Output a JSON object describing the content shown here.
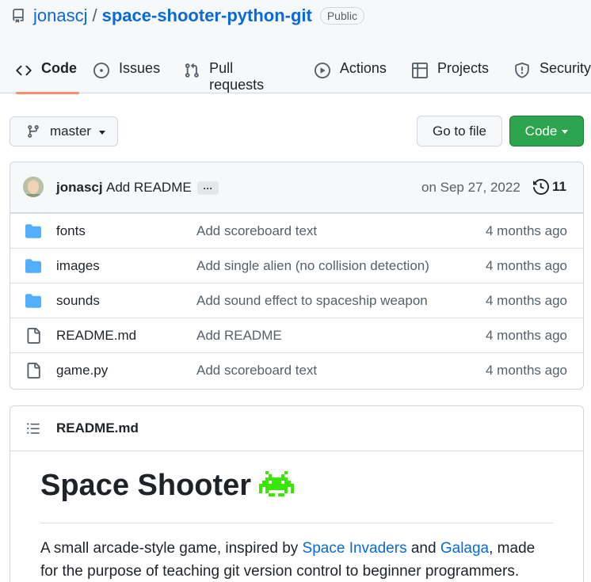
{
  "repo": {
    "owner": "jonascj",
    "separator": "/",
    "name": "space-shooter-python-git",
    "visibility": "Public"
  },
  "tabs": [
    {
      "label": "Code",
      "icon": "code-icon",
      "active": true
    },
    {
      "label": "Issues",
      "icon": "issue-opened-icon"
    },
    {
      "label": "Pull requests",
      "icon": "git-pull-request-icon"
    },
    {
      "label": "Actions",
      "icon": "play-icon"
    },
    {
      "label": "Projects",
      "icon": "table-icon"
    },
    {
      "label": "Security",
      "icon": "shield-icon"
    }
  ],
  "branch": {
    "label": "master",
    "icon": "git-branch-icon"
  },
  "buttons": {
    "goto_file": "Go to file",
    "code": "Code"
  },
  "latest_commit": {
    "author": "jonascj",
    "message": "Add README",
    "ellipsis": "···",
    "date": "on Sep 27, 2022",
    "commit_count": "11"
  },
  "files": [
    {
      "type": "folder",
      "name": "fonts",
      "message": "Add scoreboard text",
      "age": "4 months ago"
    },
    {
      "type": "folder",
      "name": "images",
      "message": "Add single alien (no collision detection)",
      "age": "4 months ago"
    },
    {
      "type": "folder",
      "name": "sounds",
      "message": "Add sound effect to spaceship weapon",
      "age": "4 months ago"
    },
    {
      "type": "file",
      "name": "README.md",
      "message": "Add README",
      "age": "4 months ago"
    },
    {
      "type": "file",
      "name": "game.py",
      "message": "Add scoreboard text",
      "age": "4 months ago"
    }
  ],
  "readme": {
    "filename": "README.md",
    "heading": "Space Shooter",
    "paragraph": {
      "before": "A small arcade-style game, inspired by ",
      "link1": "Space Invaders",
      "between": " and ",
      "link2": "Galaga",
      "after": ", made for the purpose of teaching git version control to beginner programmers."
    }
  },
  "colors": {
    "accent_blue": "#0969da",
    "green_button": "#2da44e",
    "tab_underline": "#fd8c73",
    "folder_blue": "#54aeff",
    "invader_green": "#39e600"
  }
}
